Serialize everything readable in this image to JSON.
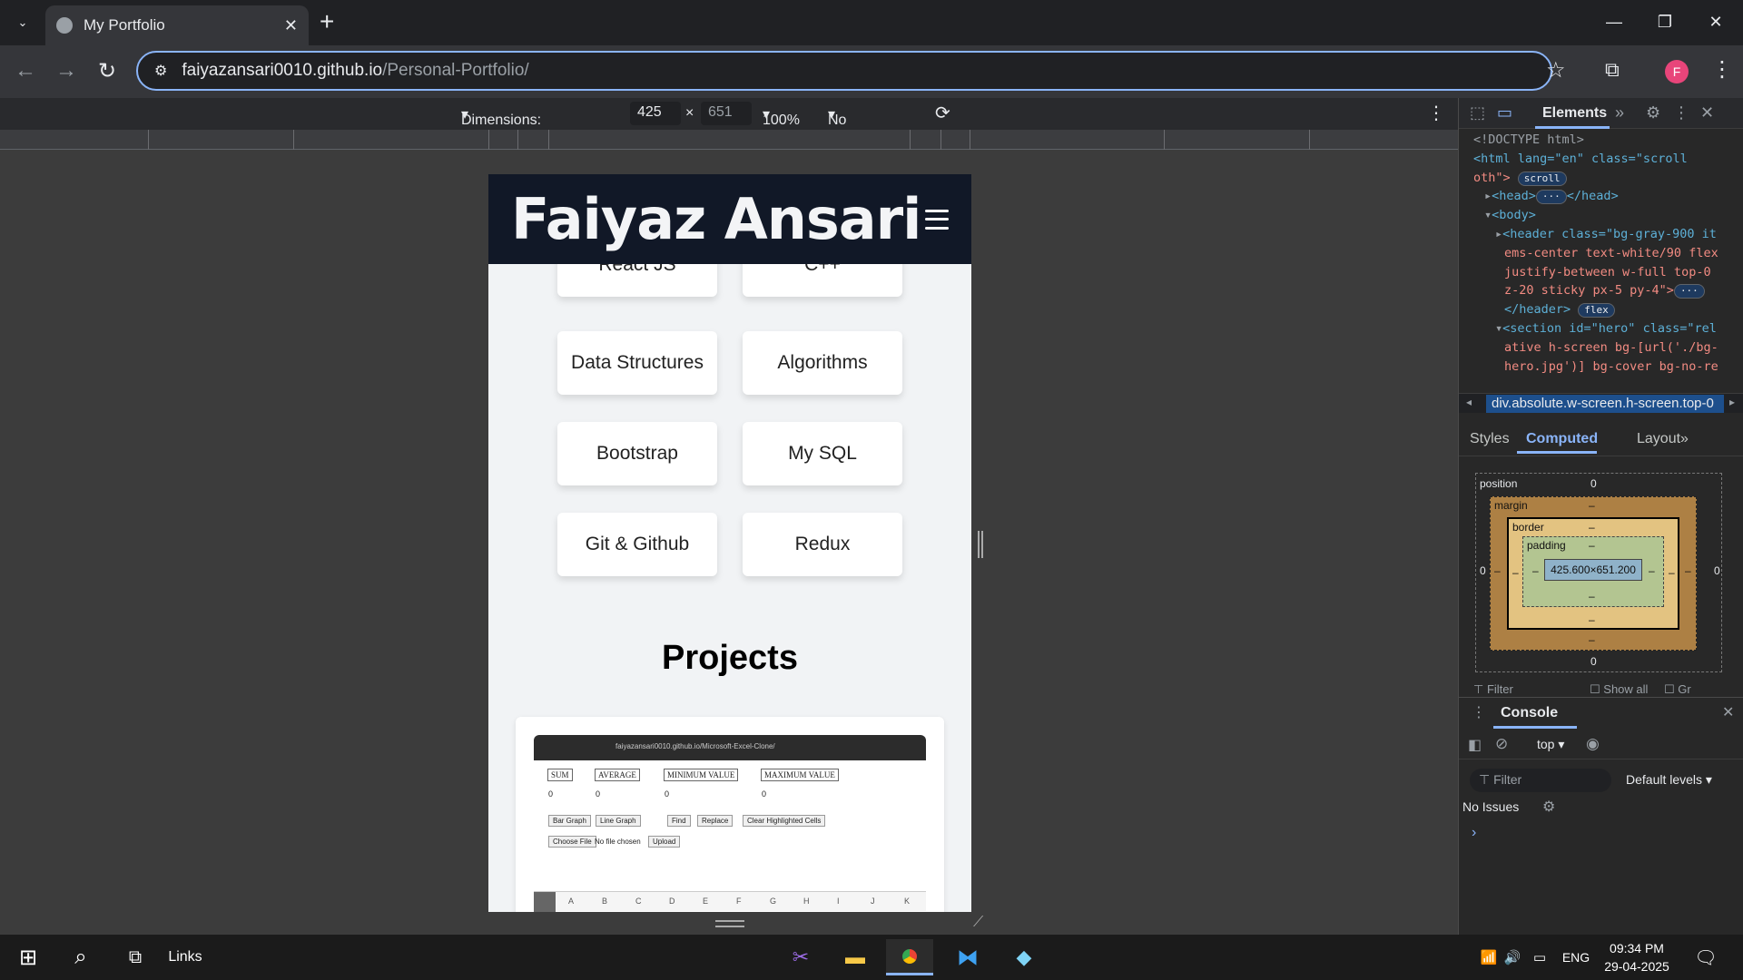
{
  "browser": {
    "tab_title": "My Portfolio",
    "url_host": "faiyazansari0010.github.io",
    "url_path": "/Personal-Portfolio/",
    "profile_initial": "F"
  },
  "device_toolbar": {
    "dimensions_label": "Dimensions: Responsive",
    "width": "425",
    "times": "×",
    "height": "651",
    "zoom": "100%",
    "throttling": "No throttling"
  },
  "site": {
    "logo": "Faiyaz Ansari",
    "skills": [
      "React JS",
      "C++",
      "Data Structures",
      "Algorithms",
      "Bootstrap",
      "My SQL",
      "Git & Github",
      "Redux"
    ],
    "projects_title": "Projects",
    "project_preview": {
      "url": "faiyazansari0010.github.io/Microsoft-Excel-Clone/",
      "stats": [
        "SUM",
        "AVERAGE",
        "MINIMUM VALUE",
        "MAXIMUM VALUE"
      ],
      "zeros": [
        "0",
        "0",
        "0",
        "0"
      ],
      "buttons": [
        "Bar Graph",
        "Line Graph",
        "Find",
        "Replace",
        "Clear Highlighted Cells"
      ],
      "file_button": "Choose File",
      "file_status": "No file chosen",
      "upload": "Upload",
      "columns": [
        "A",
        "B",
        "C",
        "D",
        "E",
        "F",
        "G",
        "H",
        "I",
        "J",
        "K"
      ]
    }
  },
  "devtools": {
    "panel": "Elements",
    "dom": {
      "doctype": "<!DOCTYPE html>",
      "html_open": "<html lang=\"en\" class=\"scroll-smooth\">",
      "html_open_a": "<html lang=\"en\" class=\"scroll",
      "html_open_b": "oth\">",
      "scroll_pill": "scroll",
      "head": "<head>",
      "head_close": "</head>",
      "ellipsis": "···",
      "body": "<body>",
      "header_1": "<header class=\"bg-gray-900 it",
      "header_2": "ems-center text-white/90 flex",
      "header_3": "justify-between w-full top-0",
      "header_4": "z-20 sticky px-5 py-4\">",
      "header_close": "</header>",
      "flex_pill": "flex",
      "section_1": "<section id=\"hero\" class=\"rel",
      "section_2": "ative h-screen bg-[url('./bg-",
      "section_3": "hero.jpg')] bg-cover bg-no-re"
    },
    "breadcrumb": "div.absolute.w-screen.h-screen.top-0",
    "subtabs": [
      "Styles",
      "Computed",
      "Layout"
    ],
    "box_model": {
      "position_label": "position",
      "position_value": "0",
      "margin_label": "margin",
      "border_label": "border",
      "padding_label": "padding",
      "content": "425.600×651.200",
      "dash": "–",
      "zero": "0"
    },
    "filter_row": "Filter",
    "show_all": "Show all",
    "group": "Gr",
    "console": {
      "title": "Console",
      "context": "top",
      "filter_placeholder": "Filter",
      "levels": "Default levels",
      "issues": "No Issues",
      "prompt": "›"
    }
  },
  "taskbar": {
    "links": "Links",
    "lang": "ENG",
    "time": "09:34 PM",
    "date": "29-04-2025"
  }
}
